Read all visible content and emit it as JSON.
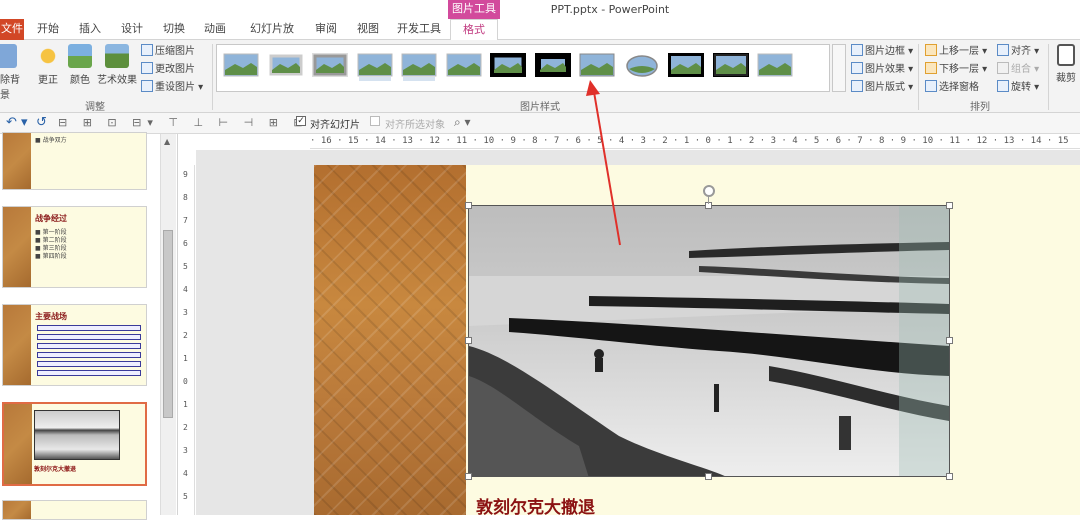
{
  "window": {
    "title": "PPT.pptx - PowerPoint",
    "context_tab_group": "图片工具"
  },
  "tabs": [
    "文件",
    "开始",
    "插入",
    "设计",
    "切换",
    "动画",
    "幻灯片放映",
    "审阅",
    "视图",
    "开发工具",
    "格式"
  ],
  "ribbon": {
    "adjust": {
      "remove_bg": "删除背景",
      "corrections": "更正",
      "color": "颜色",
      "artistic": "艺术效果",
      "compress": "压缩图片",
      "change": "更改图片",
      "reset": "重设图片",
      "group_label": "调整"
    },
    "styles": {
      "group_label": "图片样式",
      "thumb_count": 13
    },
    "style_options": {
      "border": "图片边框",
      "effects": "图片效果",
      "layout": "图片版式"
    },
    "arrange": {
      "bring_forward": "上移一层",
      "send_backward": "下移一层",
      "selection_pane": "选择窗格",
      "align": "对齐",
      "group": "组合",
      "rotate": "旋转",
      "group_label": "排列"
    },
    "size": {
      "crop": "裁剪"
    }
  },
  "quick_access": {
    "align_to_slide": "对齐幻灯片",
    "align_selected": "对齐所选对象"
  },
  "ruler": {
    "horizontal": "· 16 · 15 · 14 · 13 · 12 · 11 · 10 · 9 · 8 · 7 · 6 · 5 · 4 · 3 · 2 · 1 · 0 · 1 · 2 · 3 · 4 · 5 · 6 · 7 · 8 · 9 · 10 · 11 · 12 · 13 · 14 · 15",
    "vertical": [
      "9",
      "8",
      "7",
      "6",
      "5",
      "4",
      "3",
      "2",
      "1",
      "0",
      "1",
      "2",
      "3",
      "4",
      "5"
    ]
  },
  "slides": [
    {
      "title": "",
      "bullets": [
        "■ 战争双方"
      ]
    },
    {
      "title": "战争经过",
      "bullets": [
        "■ 第一阶段",
        "■ 第二阶段",
        "■ 第三阶段",
        "■ 第四阶段"
      ]
    },
    {
      "title": "主要战场",
      "bullets": []
    },
    {
      "title": "",
      "caption": "敦刻尔克大撤退",
      "selected": true
    },
    {
      "title": "",
      "bullets": []
    }
  ],
  "current_slide": {
    "caption": "敦刻尔克大撤退"
  },
  "colors": {
    "accent": "#d24a9c",
    "file_tab": "#d24726",
    "caption": "#8b1212",
    "arrow": "#e0302a"
  }
}
